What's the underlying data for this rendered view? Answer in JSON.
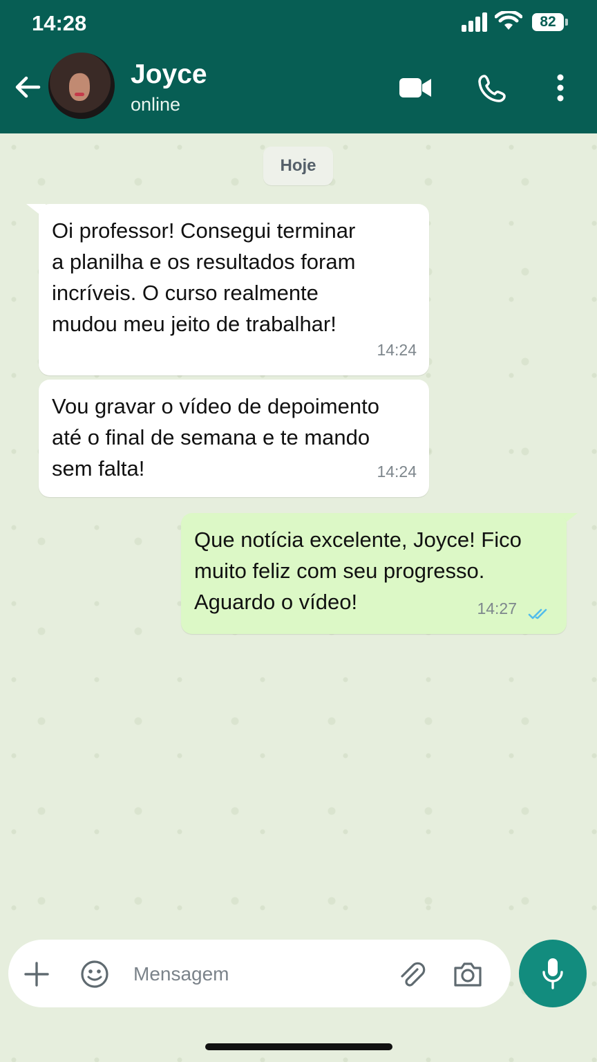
{
  "status_bar": {
    "time": "14:28",
    "battery": "82"
  },
  "header": {
    "contact_name": "Joyce",
    "contact_status": "online",
    "icons": [
      "back-arrow-icon",
      "video-call-icon",
      "phone-call-icon",
      "more-vert-icon"
    ]
  },
  "chat": {
    "date_label": "Hoje",
    "messages": [
      {
        "direction": "incoming",
        "text": "Oi professor! Consegui terminar\na planilha e os resultados foram\nincríveis. O curso realmente\nmudou meu jeito de trabalhar!",
        "time": "14:24"
      },
      {
        "direction": "incoming",
        "text": "Vou gravar o vídeo de depoimento\naté o final de semana e te mando\nsem falta!",
        "time": "14:24"
      },
      {
        "direction": "outgoing",
        "text": "Que notícia excelente, Joyce! Fico\nmuito feliz com seu progresso.\nAguardo o vídeo!",
        "time": "14:27",
        "read_status": "read"
      }
    ]
  },
  "composer": {
    "placeholder": "Mensagem",
    "icons": [
      "plus-icon",
      "emoji-icon",
      "attach-icon",
      "camera-icon",
      "mic-icon"
    ]
  },
  "colors": {
    "header": "#075e54",
    "outgoing_bubble": "#dcf8c6",
    "incoming_bubble": "#ffffff",
    "mic_button": "#128c7e",
    "read_ticks": "#53bdeb"
  }
}
